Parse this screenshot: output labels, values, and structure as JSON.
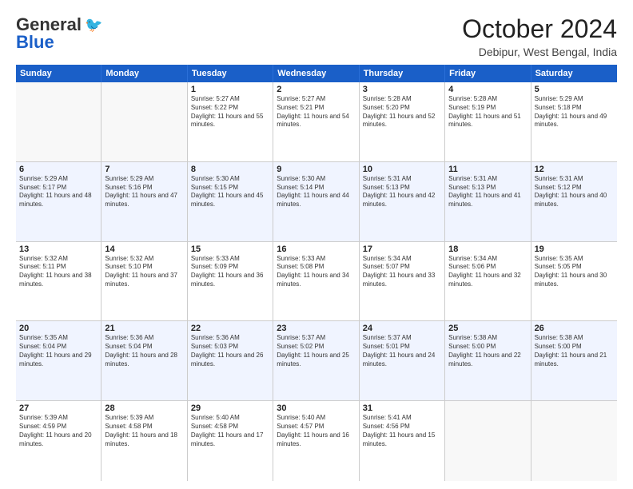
{
  "logo": {
    "line1": "General",
    "line2": "Blue"
  },
  "title": "October 2024",
  "location": "Debipur, West Bengal, India",
  "days_header": [
    "Sunday",
    "Monday",
    "Tuesday",
    "Wednesday",
    "Thursday",
    "Friday",
    "Saturday"
  ],
  "weeks": [
    [
      {
        "day": "",
        "info": ""
      },
      {
        "day": "",
        "info": ""
      },
      {
        "day": "1",
        "info": "Sunrise: 5:27 AM\nSunset: 5:22 PM\nDaylight: 11 hours and 55 minutes."
      },
      {
        "day": "2",
        "info": "Sunrise: 5:27 AM\nSunset: 5:21 PM\nDaylight: 11 hours and 54 minutes."
      },
      {
        "day": "3",
        "info": "Sunrise: 5:28 AM\nSunset: 5:20 PM\nDaylight: 11 hours and 52 minutes."
      },
      {
        "day": "4",
        "info": "Sunrise: 5:28 AM\nSunset: 5:19 PM\nDaylight: 11 hours and 51 minutes."
      },
      {
        "day": "5",
        "info": "Sunrise: 5:29 AM\nSunset: 5:18 PM\nDaylight: 11 hours and 49 minutes."
      }
    ],
    [
      {
        "day": "6",
        "info": "Sunrise: 5:29 AM\nSunset: 5:17 PM\nDaylight: 11 hours and 48 minutes."
      },
      {
        "day": "7",
        "info": "Sunrise: 5:29 AM\nSunset: 5:16 PM\nDaylight: 11 hours and 47 minutes."
      },
      {
        "day": "8",
        "info": "Sunrise: 5:30 AM\nSunset: 5:15 PM\nDaylight: 11 hours and 45 minutes."
      },
      {
        "day": "9",
        "info": "Sunrise: 5:30 AM\nSunset: 5:14 PM\nDaylight: 11 hours and 44 minutes."
      },
      {
        "day": "10",
        "info": "Sunrise: 5:31 AM\nSunset: 5:13 PM\nDaylight: 11 hours and 42 minutes."
      },
      {
        "day": "11",
        "info": "Sunrise: 5:31 AM\nSunset: 5:13 PM\nDaylight: 11 hours and 41 minutes."
      },
      {
        "day": "12",
        "info": "Sunrise: 5:31 AM\nSunset: 5:12 PM\nDaylight: 11 hours and 40 minutes."
      }
    ],
    [
      {
        "day": "13",
        "info": "Sunrise: 5:32 AM\nSunset: 5:11 PM\nDaylight: 11 hours and 38 minutes."
      },
      {
        "day": "14",
        "info": "Sunrise: 5:32 AM\nSunset: 5:10 PM\nDaylight: 11 hours and 37 minutes."
      },
      {
        "day": "15",
        "info": "Sunrise: 5:33 AM\nSunset: 5:09 PM\nDaylight: 11 hours and 36 minutes."
      },
      {
        "day": "16",
        "info": "Sunrise: 5:33 AM\nSunset: 5:08 PM\nDaylight: 11 hours and 34 minutes."
      },
      {
        "day": "17",
        "info": "Sunrise: 5:34 AM\nSunset: 5:07 PM\nDaylight: 11 hours and 33 minutes."
      },
      {
        "day": "18",
        "info": "Sunrise: 5:34 AM\nSunset: 5:06 PM\nDaylight: 11 hours and 32 minutes."
      },
      {
        "day": "19",
        "info": "Sunrise: 5:35 AM\nSunset: 5:05 PM\nDaylight: 11 hours and 30 minutes."
      }
    ],
    [
      {
        "day": "20",
        "info": "Sunrise: 5:35 AM\nSunset: 5:04 PM\nDaylight: 11 hours and 29 minutes."
      },
      {
        "day": "21",
        "info": "Sunrise: 5:36 AM\nSunset: 5:04 PM\nDaylight: 11 hours and 28 minutes."
      },
      {
        "day": "22",
        "info": "Sunrise: 5:36 AM\nSunset: 5:03 PM\nDaylight: 11 hours and 26 minutes."
      },
      {
        "day": "23",
        "info": "Sunrise: 5:37 AM\nSunset: 5:02 PM\nDaylight: 11 hours and 25 minutes."
      },
      {
        "day": "24",
        "info": "Sunrise: 5:37 AM\nSunset: 5:01 PM\nDaylight: 11 hours and 24 minutes."
      },
      {
        "day": "25",
        "info": "Sunrise: 5:38 AM\nSunset: 5:00 PM\nDaylight: 11 hours and 22 minutes."
      },
      {
        "day": "26",
        "info": "Sunrise: 5:38 AM\nSunset: 5:00 PM\nDaylight: 11 hours and 21 minutes."
      }
    ],
    [
      {
        "day": "27",
        "info": "Sunrise: 5:39 AM\nSunset: 4:59 PM\nDaylight: 11 hours and 20 minutes."
      },
      {
        "day": "28",
        "info": "Sunrise: 5:39 AM\nSunset: 4:58 PM\nDaylight: 11 hours and 18 minutes."
      },
      {
        "day": "29",
        "info": "Sunrise: 5:40 AM\nSunset: 4:58 PM\nDaylight: 11 hours and 17 minutes."
      },
      {
        "day": "30",
        "info": "Sunrise: 5:40 AM\nSunset: 4:57 PM\nDaylight: 11 hours and 16 minutes."
      },
      {
        "day": "31",
        "info": "Sunrise: 5:41 AM\nSunset: 4:56 PM\nDaylight: 11 hours and 15 minutes."
      },
      {
        "day": "",
        "info": ""
      },
      {
        "day": "",
        "info": ""
      }
    ]
  ]
}
